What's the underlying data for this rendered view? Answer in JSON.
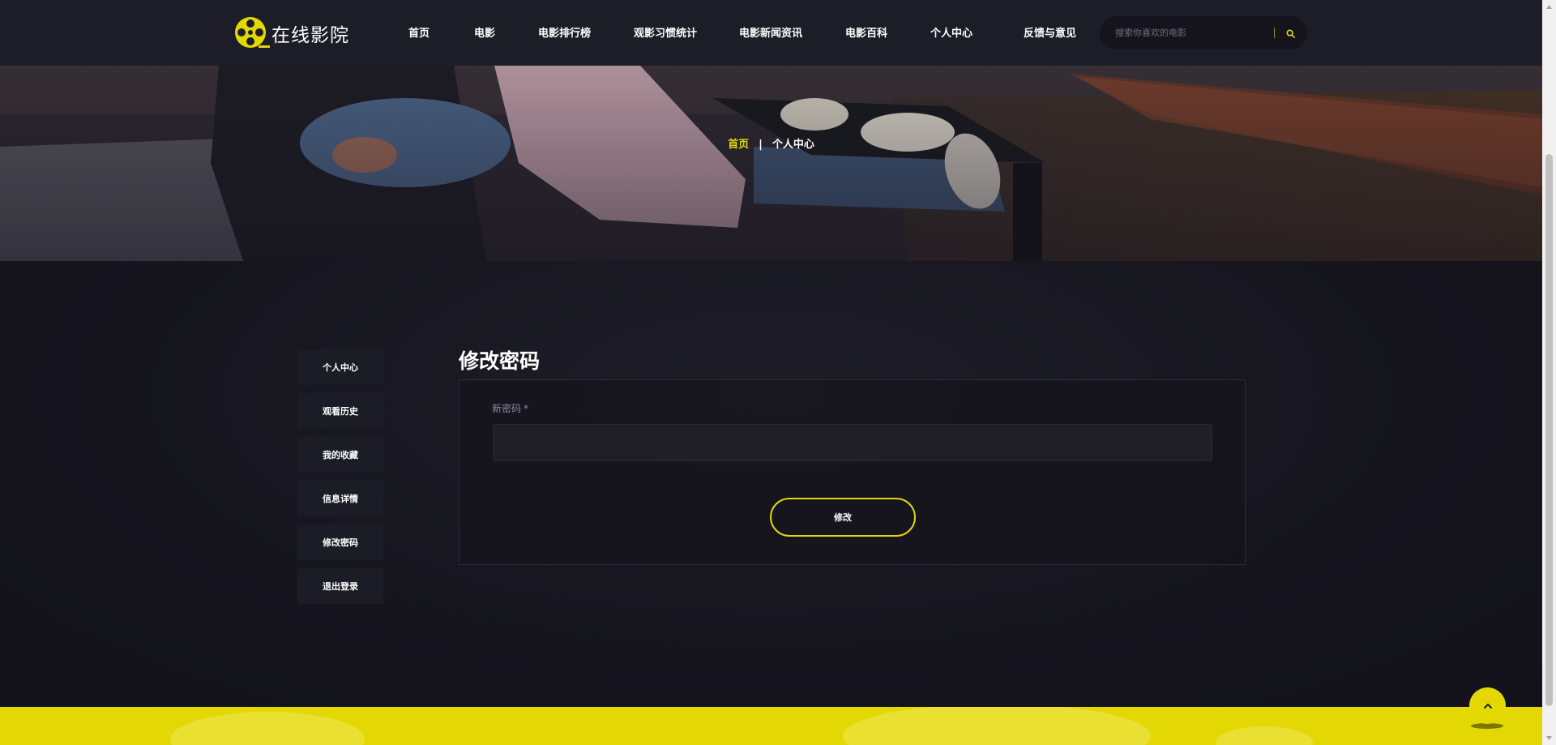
{
  "header": {
    "logo_text": "在线影院",
    "nav": [
      {
        "label": "首页"
      },
      {
        "label": "电影"
      },
      {
        "label": "电影排行榜"
      },
      {
        "label": "观影习惯统计"
      },
      {
        "label": "电影新闻资讯"
      },
      {
        "label": "电影百科"
      },
      {
        "label": "个人中心"
      },
      {
        "label": "反馈与意见"
      }
    ],
    "search": {
      "placeholder": "搜索你喜欢的电影",
      "value": ""
    }
  },
  "breadcrumb": {
    "home": "首页",
    "separator": "|",
    "current": "个人中心"
  },
  "sidebar": {
    "items": [
      {
        "label": "个人中心"
      },
      {
        "label": "观看历史"
      },
      {
        "label": "我的收藏"
      },
      {
        "label": "信息详情"
      },
      {
        "label": "修改密码"
      },
      {
        "label": "退出登录"
      }
    ]
  },
  "form": {
    "title": "修改密码",
    "field_label": "新密码",
    "required_mark": "*",
    "field_value": "",
    "submit_label": "修改"
  },
  "colors": {
    "accent": "#e3d804",
    "header_bg": "#1d1d28",
    "page_bg": "#15141d",
    "panel_border": "#2b2b36",
    "input_bg": "#1f1f25"
  },
  "icons": {
    "logo": "film-reel-icon",
    "search": "search-icon",
    "back_to_top": "chevron-up-icon"
  }
}
